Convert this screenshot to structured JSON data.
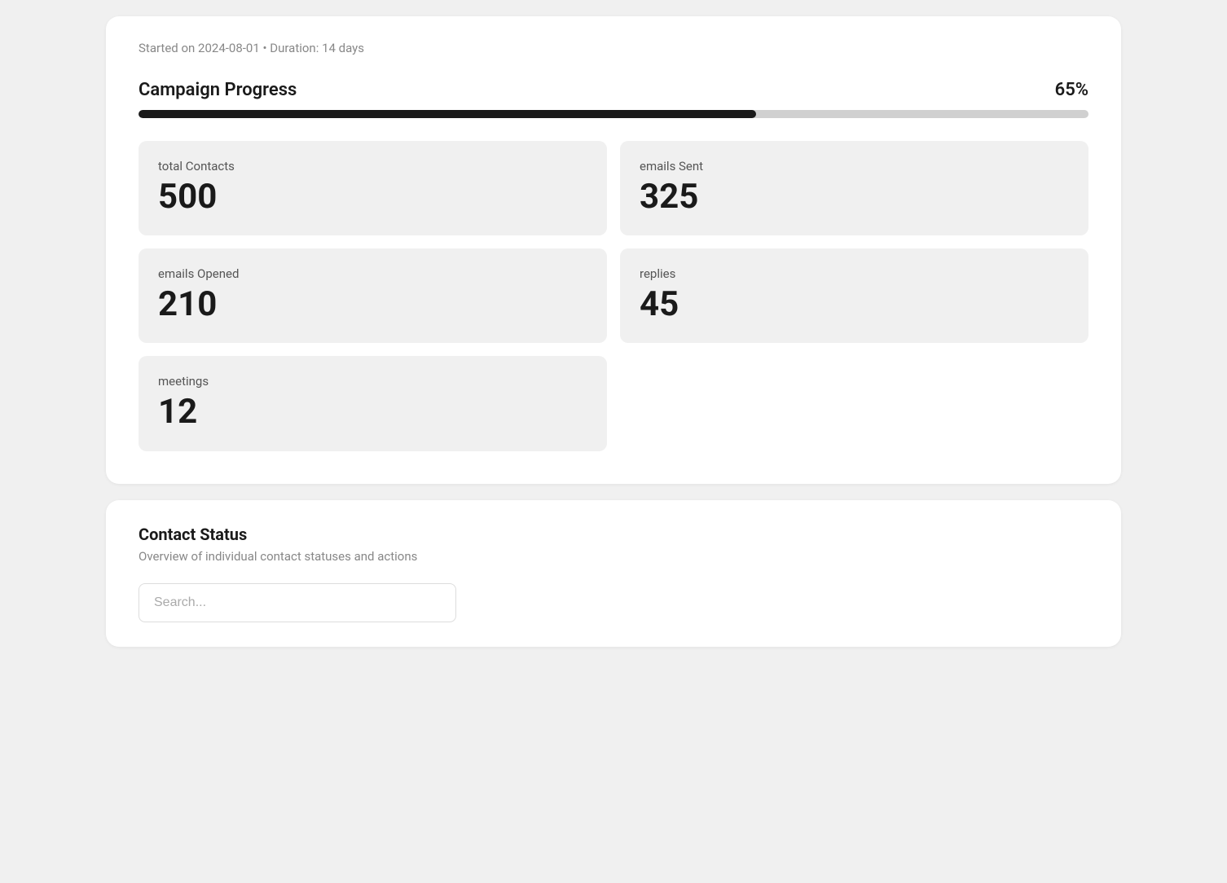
{
  "campaign": {
    "meta": "Started on 2024-08-01 • Duration: 14 days",
    "progress_title": "Campaign Progress",
    "progress_percent": "65%",
    "progress_value": 65
  },
  "stats": [
    {
      "id": "total-contacts",
      "label": "total Contacts",
      "value": "500"
    },
    {
      "id": "emails-sent",
      "label": "emails Sent",
      "value": "325"
    },
    {
      "id": "emails-opened",
      "label": "emails Opened",
      "value": "210"
    },
    {
      "id": "replies",
      "label": "replies",
      "value": "45"
    },
    {
      "id": "meetings",
      "label": "meetings",
      "value": "12"
    }
  ],
  "contact_status": {
    "title": "Contact Status",
    "subtitle": "Overview of individual contact statuses and actions",
    "search_placeholder": "Search..."
  }
}
